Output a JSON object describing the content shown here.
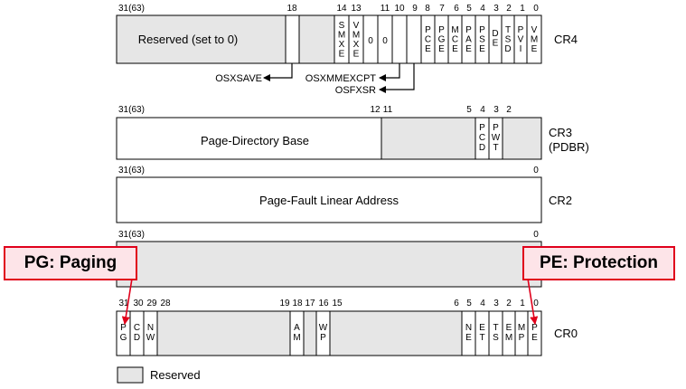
{
  "cr4": {
    "name": "CR4",
    "top_bits": [
      {
        "id": "31",
        "label": "31(63)"
      },
      {
        "id": "18",
        "label": "18"
      },
      {
        "id": "14",
        "label": "14"
      },
      {
        "id": "13",
        "label": "13"
      },
      {
        "id": "11",
        "label": "11"
      },
      {
        "id": "10",
        "label": "10"
      },
      {
        "id": "9",
        "label": "9"
      },
      {
        "id": "8",
        "label": "8"
      },
      {
        "id": "7",
        "label": "7"
      },
      {
        "id": "6",
        "label": "6"
      },
      {
        "id": "5",
        "label": "5"
      },
      {
        "id": "4",
        "label": "4"
      },
      {
        "id": "3",
        "label": "3"
      },
      {
        "id": "2",
        "label": "2"
      },
      {
        "id": "1",
        "label": "1"
      },
      {
        "id": "0",
        "label": "0"
      }
    ],
    "reserved_label": "Reserved (set to 0)",
    "fields": [
      {
        "id": "smxe",
        "letters": [
          "S",
          "M",
          "X",
          "E"
        ]
      },
      {
        "id": "vmxe",
        "letters": [
          "V",
          "M",
          "X",
          "E"
        ]
      },
      {
        "id": "zero12",
        "letters": [
          "0"
        ]
      },
      {
        "id": "zero11",
        "letters": [
          "0"
        ]
      },
      {
        "id": "pce",
        "letters": [
          "P",
          "C",
          "E"
        ]
      },
      {
        "id": "pge",
        "letters": [
          "P",
          "G",
          "E"
        ]
      },
      {
        "id": "mce",
        "letters": [
          "M",
          "C",
          "E"
        ]
      },
      {
        "id": "pae",
        "letters": [
          "P",
          "A",
          "E"
        ]
      },
      {
        "id": "pse",
        "letters": [
          "P",
          "S",
          "E"
        ]
      },
      {
        "id": "de",
        "letters": [
          "D",
          "E"
        ]
      },
      {
        "id": "tsd",
        "letters": [
          "T",
          "S",
          "D"
        ]
      },
      {
        "id": "pvi",
        "letters": [
          "P",
          "V",
          "I"
        ]
      },
      {
        "id": "vme",
        "letters": [
          "V",
          "M",
          "E"
        ]
      }
    ],
    "pointers": {
      "osxsave": "OSXSAVE",
      "osxmmexcpt": "OSXMMEXCPT",
      "osfxsr": "OSFXSR"
    }
  },
  "cr3": {
    "name": "CR3",
    "alias": "(PDBR)",
    "top_bits": [
      {
        "id": "31",
        "label": "31(63)"
      },
      {
        "id": "12",
        "label": "12"
      },
      {
        "id": "11",
        "label": "11"
      },
      {
        "id": "5",
        "label": "5"
      },
      {
        "id": "4",
        "label": "4"
      },
      {
        "id": "3",
        "label": "3"
      },
      {
        "id": "2",
        "label": "2"
      }
    ],
    "base_label": "Page-Directory Base",
    "fields": [
      {
        "id": "pcd",
        "letters": [
          "P",
          "C",
          "D"
        ]
      },
      {
        "id": "pwt",
        "letters": [
          "P",
          "W",
          "T"
        ]
      }
    ]
  },
  "cr2": {
    "name": "CR2",
    "top_bits": [
      {
        "id": "31",
        "label": "31(63)"
      },
      {
        "id": "0",
        "label": "0"
      }
    ],
    "label": "Page-Fault Linear Address"
  },
  "cr1": {
    "top_bits": [
      {
        "id": "31",
        "label": "31(63)"
      },
      {
        "id": "0",
        "label": "0"
      }
    ]
  },
  "cr0": {
    "name": "CR0",
    "top_bits": [
      {
        "id": "31",
        "label": "31"
      },
      {
        "id": "30",
        "label": "30"
      },
      {
        "id": "29",
        "label": "29"
      },
      {
        "id": "28",
        "label": "28"
      },
      {
        "id": "19",
        "label": "19"
      },
      {
        "id": "18",
        "label": "18"
      },
      {
        "id": "17",
        "label": "17"
      },
      {
        "id": "16",
        "label": "16"
      },
      {
        "id": "15",
        "label": "15"
      },
      {
        "id": "6",
        "label": "6"
      },
      {
        "id": "5",
        "label": "5"
      },
      {
        "id": "4",
        "label": "4"
      },
      {
        "id": "3",
        "label": "3"
      },
      {
        "id": "2",
        "label": "2"
      },
      {
        "id": "1",
        "label": "1"
      },
      {
        "id": "0",
        "label": "0"
      }
    ],
    "fields": [
      {
        "id": "pg",
        "letters": [
          "P",
          "G"
        ]
      },
      {
        "id": "cd",
        "letters": [
          "C",
          "D"
        ]
      },
      {
        "id": "nw",
        "letters": [
          "N",
          "W"
        ]
      },
      {
        "id": "am",
        "letters": [
          "A",
          "M"
        ]
      },
      {
        "id": "wp",
        "letters": [
          "W",
          "P"
        ]
      },
      {
        "id": "ne",
        "letters": [
          "N",
          "E"
        ]
      },
      {
        "id": "et",
        "letters": [
          "E",
          "T"
        ]
      },
      {
        "id": "ts",
        "letters": [
          "T",
          "S"
        ]
      },
      {
        "id": "em",
        "letters": [
          "E",
          "M"
        ]
      },
      {
        "id": "mp",
        "letters": [
          "M",
          "P"
        ]
      },
      {
        "id": "pe",
        "letters": [
          "P",
          "E"
        ]
      }
    ]
  },
  "callouts": {
    "pg": "PG: Paging",
    "pe": "PE: Protection"
  },
  "legend": {
    "label": "Reserved"
  },
  "colors": {
    "reserved_fill": "#e6e6e6",
    "field_fill": "#ffffff",
    "outline": "#000000",
    "callout_border": "#e0001b",
    "callout_fill": "#fde4e8",
    "arrow": "#e0001b"
  }
}
